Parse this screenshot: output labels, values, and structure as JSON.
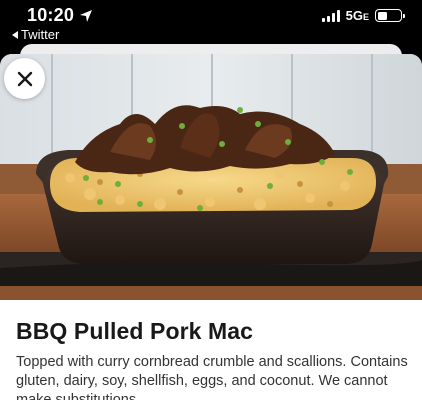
{
  "status_bar": {
    "time": "10:20",
    "back_app": "Twitter",
    "network": "5G",
    "network_suffix": "E",
    "battery_level": 0.45
  },
  "colors": {
    "accent_text": "#191919",
    "status_bar_bg": "#000000"
  },
  "modal": {
    "close_icon": "close-icon",
    "item": {
      "name": "BBQ Pulled Pork Mac",
      "description": "Topped with curry cornbread crumble and scallions. Contains gluten, dairy, soy, shellfish, eggs, and coconut. We cannot make substitutions."
    }
  }
}
